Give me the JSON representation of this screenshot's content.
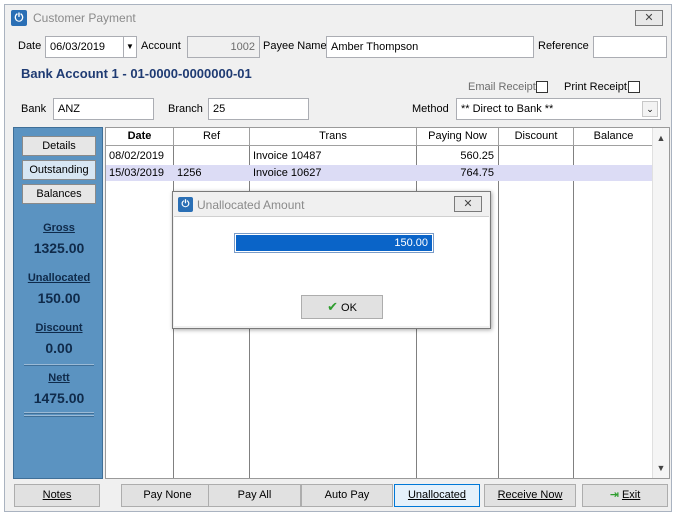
{
  "window": {
    "title": "Customer Payment",
    "close_glyph": "✕"
  },
  "header": {
    "date_label": "Date",
    "date_value": "06/03/2019",
    "account_label": "Account",
    "account_value": "1002",
    "payee_label": "Payee Name",
    "payee_value": "Amber Thompson",
    "reference_label": "Reference",
    "reference_value": "",
    "bank_account_heading": "Bank Account 1 - 01-0000-0000000-01",
    "email_receipt_label": "Email Receipt",
    "print_receipt_label": "Print Receipt",
    "bank_label": "Bank",
    "bank_value": "ANZ",
    "branch_label": "Branch",
    "branch_value": "25",
    "method_label": "Method",
    "method_value": "** Direct to Bank **"
  },
  "sidebar": {
    "buttons": [
      "Details",
      "Outstanding",
      "Balances"
    ],
    "stats": [
      {
        "label": "Gross",
        "value": "1325.00"
      },
      {
        "label": "Unallocated",
        "value": "150.00"
      },
      {
        "label": "Discount",
        "value": "0.00"
      },
      {
        "label": "Nett",
        "value": "1475.00"
      }
    ]
  },
  "table": {
    "columns": [
      "Date",
      "Ref",
      "Trans",
      "Paying Now",
      "Discount",
      "Balance"
    ],
    "rows": [
      {
        "date": "08/02/2019",
        "ref": "",
        "trans": "Invoice 10487",
        "paying_now": "560.25",
        "discount": "",
        "balance": ""
      },
      {
        "date": "15/03/2019",
        "ref": "1256",
        "trans": "Invoice 10627",
        "paying_now": "764.75",
        "discount": "",
        "balance": ""
      }
    ]
  },
  "footer": {
    "notes": "Notes",
    "pay_none": "Pay None",
    "pay_all": "Pay All",
    "auto_pay": "Auto Pay",
    "unallocated": "Unallocated",
    "receive_now": "Receive Now",
    "exit": "Exit"
  },
  "modal": {
    "title": "Unallocated Amount",
    "value": "150.00",
    "ok_label": "OK",
    "close_glyph": "✕"
  },
  "colors": {
    "sidebar_bg": "#5b93c1",
    "heading": "#1f3b73",
    "selection": "#0a64c8",
    "row_selected": "#dcdcf5"
  },
  "icons": [
    "app-power-icon",
    "close-icon",
    "dropdown-arrow-icon",
    "scroll-up-icon",
    "scroll-down-icon",
    "check-icon",
    "exit-door-icon"
  ]
}
